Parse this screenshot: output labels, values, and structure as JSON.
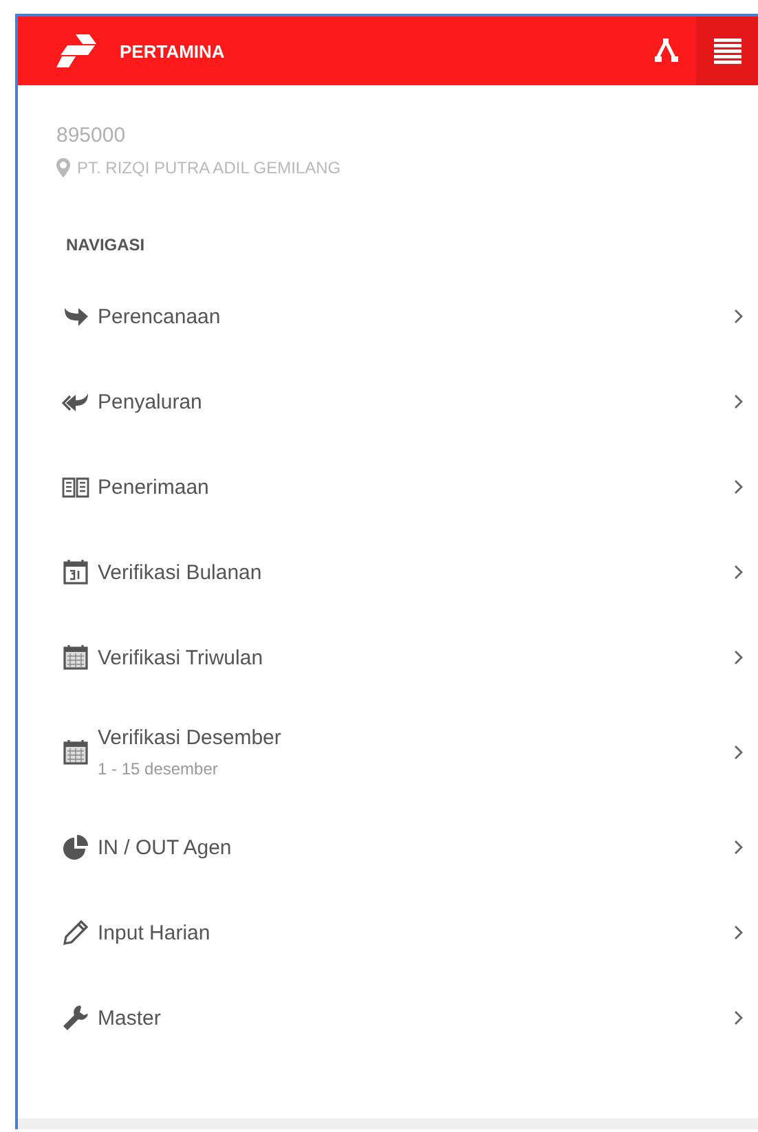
{
  "header": {
    "brand": "PERTAMINA"
  },
  "account": {
    "id": "895000",
    "company": "PT. RIZQI PUTRA ADIL GEMILANG"
  },
  "nav": {
    "heading": "NAVIGASI",
    "items": [
      {
        "label": "Perencanaan"
      },
      {
        "label": "Penyaluran"
      },
      {
        "label": "Penerimaan"
      },
      {
        "label": "Verifikasi Bulanan"
      },
      {
        "label": "Verifikasi Triwulan"
      },
      {
        "label": "Verifikasi Desember",
        "sublabel": "1 - 15 desember"
      },
      {
        "label": "IN / OUT Agen"
      },
      {
        "label": "Input Harian"
      },
      {
        "label": "Master"
      }
    ]
  }
}
